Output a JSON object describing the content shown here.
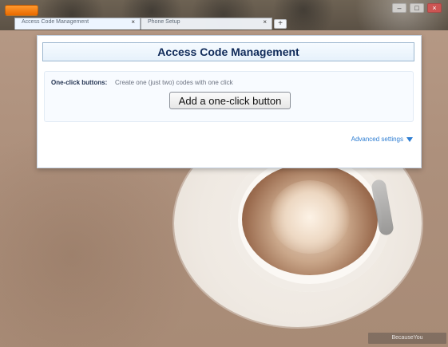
{
  "browser": {
    "tabs": [
      {
        "label": "Access Code Management",
        "active": true
      },
      {
        "label": "Phone Setup",
        "active": false
      }
    ],
    "new_tab_symbol": "+",
    "window_controls": [
      "–",
      "□",
      "×"
    ]
  },
  "panel": {
    "title": "Access Code Management",
    "one_click": {
      "label": "One-click buttons:",
      "description": "Create one (just two) codes with one click",
      "button_label": "Add a one-click button"
    },
    "advanced_settings": "Advanced settings"
  },
  "overlay": {
    "watermark": "BecauseYou"
  },
  "colors": {
    "title_text": "#0f2a59",
    "link": "#2d7dd2",
    "header_border": "#9db7cf"
  },
  "icons": {
    "advanced_settings_icon": "chevron-down-icon",
    "tab_close_icon": "close-icon",
    "new_tab_icon": "plus-icon"
  }
}
